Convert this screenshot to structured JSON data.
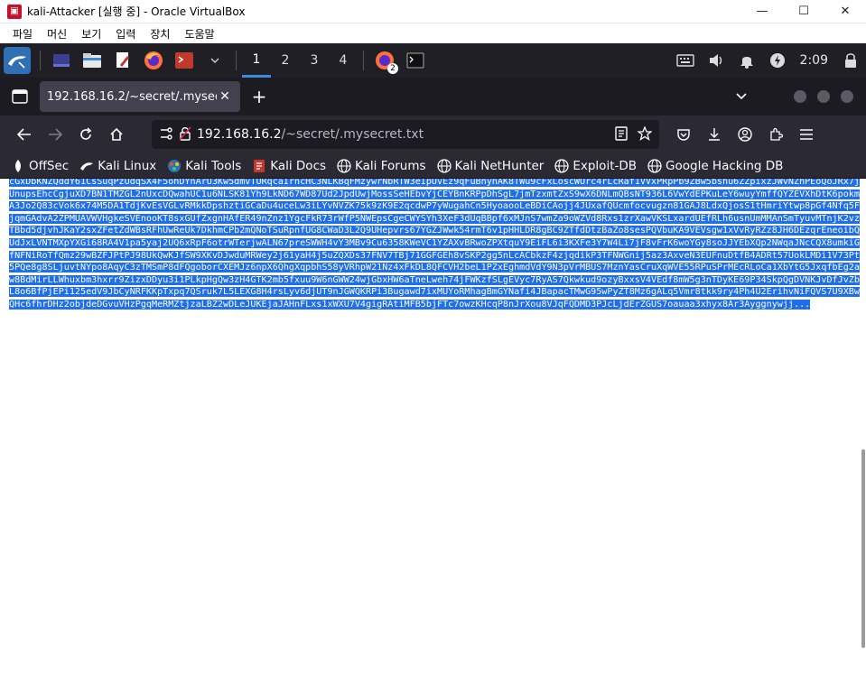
{
  "window": {
    "title": "kali-Attacker [실행 중] - Oracle VirtualBox",
    "minimize": "—",
    "maximize": "☐",
    "close": "✕"
  },
  "vbox_menu": [
    "파일",
    "머신",
    "보기",
    "입력",
    "장치",
    "도움말"
  ],
  "panel": {
    "workspaces": [
      "1",
      "2",
      "3",
      "4"
    ],
    "active_workspace": "1",
    "firefox_badge": "2",
    "clock": "2:09"
  },
  "tab": {
    "title": "192.168.16.2/~secret/.mysecret.txt",
    "close": "✕",
    "new_tab": "+"
  },
  "url": {
    "host": "192.168.16.2",
    "path": "/~secret/.mysecret.txt"
  },
  "bookmarks": [
    "OffSec",
    "Kali Linux",
    "Kali Tools",
    "Kali Docs",
    "Kali Forums",
    "Kali NetHunter",
    "Exploit-DB",
    "Google Hacking DB"
  ],
  "file_content": "cGxDbKNZQddY61CsSuqPzUdqSX4F5ohDYnArU3Kw5dmvTURqcaIrncHC3NLKBqFMzywrNbRTW3eIpUvEz9qFuBnynAK8TWu9cFxLoscWUrc4rLcRaf1VVxPRpPb9ZBw5bshu6ZZpixzJWvNZhPEoQoJRx7jUnupsEhcCgjuXD7BN1TMZGL2nUxcDQwahUC1u6NLSK81Yh9LkND67WD87Ud2JpdUwjMossSeHEbvYjCEYBnKRPpDhSgL7jmTzxmtZxS9wX6DNLmQBsNT936L6VwYdEPKuLeY6wuyYmffQYZEVXhDtK6pokmA3Jo2Q83cVok6x74M5DA1TdjKvEsVGLvRMkkDpshztiGCaDu4uceLw3iLYvNVZK75k9zK9E2qcdwP7yWugahCn5HyoaooLeBDiCAojj4JUxafQUcmfocvugzn81GAJ8LdxQjosS1tHmriYtwp8pGf4Nfq5FjqmGAdvA2ZPMUAVWVHgkeSVEnooKT8sxGUfZxgnHAfER49nZnz1YgcFkR73rWfP5NWEpsCgeCWYSYh3XeF3dUqBBpf6xMJnS7wmZa9oWZVd8Rxs1zrXawVKSLxardUEfRLh6usnUmMMAnSmTyuvMTnjK2vzTBbd5djvhJKaY2sxZFetZdWBsRFhUwReUk7DkhmCPb2mQNoTSuRpnfUG8CWaD3L2Q9UHepvrs67YGZJWwk54rmT6v1pHHLDR8gBC9ZTfdDtzBaZo8sesPQVbuKA9VEVsgw1xVvRyRZz8JH6DEzqrEneoibQUdJxLVNTMXpYXGi68RA4V1pa5yaj2UQ6xRpF6otrWTerjwALN67preSWWH4vY3MBv9Cu6358KWeVC1YZAXvBRwoZPXtquY9EiFL6i3KXFe3Y7W4Li7jF8vFrK6woYGy8soJJYEbXQp2NWqaJNcCQX8umkiGfNFNiRoTfQmz29wBZFJPtPJ98UkQwKJfSW9XKvDJwduMRWey2j61yaH4j5uZQXDs37FNV7TBj71GGFGEh8vSKP2gg5nLcACbkzF4zjqdikP3TFNWGnij5az3AxveN3EUFnuDtfB4ADRt57UokLMDi1V73Pt5PQe8g8SLjuvtNYpo8AqyC3zTMSmP8dFQgoborCXEMJz6npX6QhgXqpbhS58yVRhpW21Nz4xFkDL8QFCVH2beL1PZxEghmdVdY9N3pVrMBUS7MznYasCruXqWVE55RPuSPrMEcRLoCa1XbYtG5JxqfbEg2aw8BdMirLLWhuxbm3hxrr9ZizxDDyu3i1PLkpHgQw3zH4GTK2mb5fxuu9W6nGWW24wjGbxHW6aTneLweh74jFWKzfSLgEVyc7RyAS7Qkwkud9ozyBxxsV4VEdf8mW5g3nTDyKE69P34SkpQgDVNKJvDfJvZbL8o6BfPjEPi125edV9JbCyNRFKKpTxpq7QSruk7L5LEXG8H4rsLyv6djUT9nJGWQKRPi3Bugawd7ixMUYoRMhagBmGYNafi4JBapacTMwG95wPyZT8Mz6gALq5Vmr8tkk9ry4Ph4U2ErihvNiFQVS7U9XBwQHc6fhrDHz2objdeDGvuVHzPgqMeRMZtjzaLBZ2wDLeJUKEjaJAHnFLxs1xWXU7V4gigRAtiMFB5bjFTc7owzKHcqP8nJrXou8VJqFQDMD3PJcLjdErZGUS7oauaa3xhyx8Ar3Ayggnywjj..."
}
